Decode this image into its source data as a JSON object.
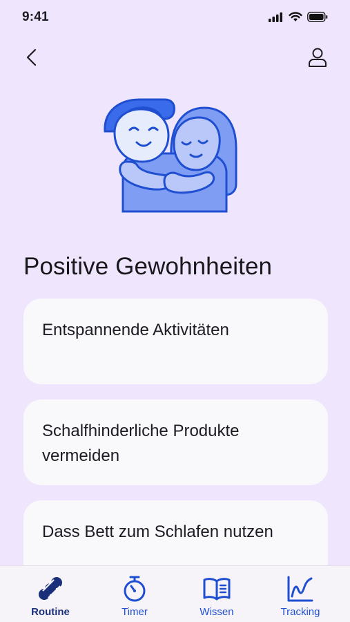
{
  "status": {
    "time": "9:41"
  },
  "header": {
    "back_icon": "chevron-left-icon",
    "profile_icon": "user-icon"
  },
  "main": {
    "title": "Positive Gewohnheiten",
    "cards": [
      {
        "label": "Entspannende Aktivitäten"
      },
      {
        "label": "Schalfhinderliche Produkte vermeiden"
      },
      {
        "label": "Dass Bett zum Schlafen nutzen"
      }
    ]
  },
  "tabbar": {
    "items": [
      {
        "label": "Routine",
        "icon": "routine-icon",
        "active": true
      },
      {
        "label": "Timer",
        "icon": "stopwatch-icon"
      },
      {
        "label": "Wissen",
        "icon": "book-icon"
      },
      {
        "label": "Tracking",
        "icon": "chart-icon"
      }
    ]
  },
  "colors": {
    "background": "#efe6fd",
    "accent": "#1f4fd0",
    "active": "#1a2f7a",
    "card": "#f9f8fb"
  }
}
